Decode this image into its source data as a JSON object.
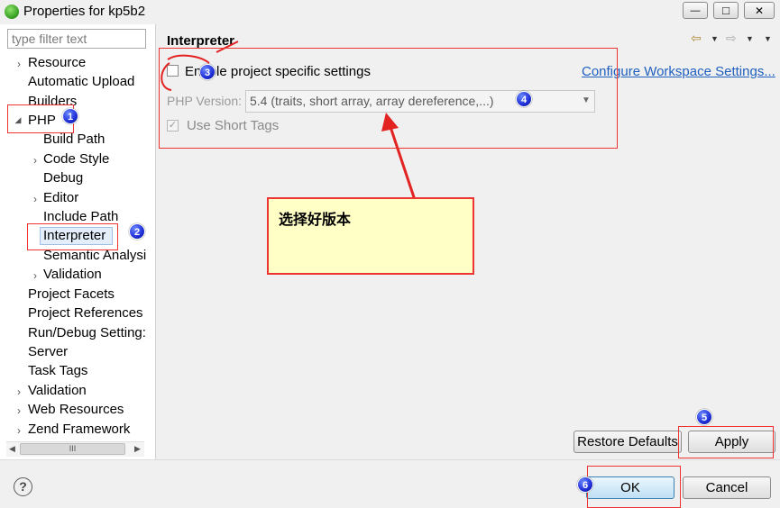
{
  "window": {
    "title": "Properties for kp5b2",
    "min_glyph": "—",
    "max_glyph": "□",
    "close_glyph": "✕"
  },
  "sidebar": {
    "filter_placeholder": "type filter text",
    "items": [
      {
        "label": "Resource",
        "chevron": "›"
      },
      {
        "label": "Automatic Upload",
        "chevron": ""
      },
      {
        "label": "Builders",
        "chevron": ""
      },
      {
        "label": "PHP",
        "chevron": "◢"
      },
      {
        "label": "Build Path",
        "chevron": ""
      },
      {
        "label": "Code Style",
        "chevron": "›"
      },
      {
        "label": "Debug",
        "chevron": ""
      },
      {
        "label": "Editor",
        "chevron": "›"
      },
      {
        "label": "Include Path",
        "chevron": ""
      },
      {
        "label": "Interpreter",
        "chevron": ""
      },
      {
        "label": "Semantic Analysi",
        "chevron": ""
      },
      {
        "label": "Validation",
        "chevron": "›"
      },
      {
        "label": "Project Facets",
        "chevron": ""
      },
      {
        "label": "Project References",
        "chevron": ""
      },
      {
        "label": "Run/Debug Setting:",
        "chevron": ""
      },
      {
        "label": "Server",
        "chevron": ""
      },
      {
        "label": "Task Tags",
        "chevron": ""
      },
      {
        "label": "Validation",
        "chevron": "›"
      },
      {
        "label": "Web Resources",
        "chevron": "›"
      },
      {
        "label": "Zend Framework",
        "chevron": "›"
      }
    ],
    "scroll_left": "◀",
    "scroll_right": "▶",
    "scroll_thumb_grip": "III"
  },
  "content": {
    "title": "Interpreter",
    "enable_label": "Enable project specific settings",
    "configure_link": "Configure Workspace Settings...",
    "php_version_label": "PHP Version:",
    "php_version_value": "5.4 (traits, short array, array dereference,...)",
    "select_arrow": "▼",
    "short_tags_label": "Use Short Tags",
    "short_tags_check": "✓",
    "nav_back": "⇦",
    "nav_forward": "⇨",
    "nav_menu": "▼"
  },
  "buttons": {
    "restore_defaults": "Restore Defaults",
    "apply": "Apply",
    "ok": "OK",
    "cancel": "Cancel",
    "help": "?"
  },
  "annotations": {
    "note": "选择好版本",
    "badges": [
      "1",
      "2",
      "3",
      "4",
      "5",
      "6"
    ]
  }
}
